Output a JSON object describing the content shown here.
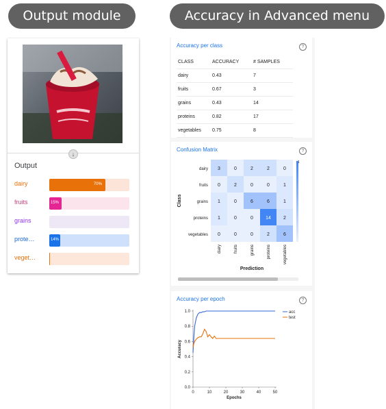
{
  "header": {
    "left_pill": "Output module",
    "right_pill": "Accuracy in Advanced menu"
  },
  "output": {
    "title": "Output",
    "rows": [
      {
        "label": "dairy",
        "value": 0.7,
        "pct": "70%",
        "color": "#e8710a",
        "track": "#fde4d8",
        "text_color": "#e8710a"
      },
      {
        "label": "fruits",
        "value": 0.15,
        "pct": "15%",
        "color": "#e52592",
        "track": "#fce4ec",
        "text_color": "#d93d7b"
      },
      {
        "label": "grains",
        "value": 0.0,
        "pct": "",
        "color": "#9334e6",
        "track": "#ede7f6",
        "text_color": "#9334e6"
      },
      {
        "label": "prote…",
        "value": 0.14,
        "pct": "14%",
        "color": "#1a73e8",
        "track": "#cfe0fc",
        "text_color": "#1967d2"
      },
      {
        "label": "veget…",
        "value": 0.01,
        "pct": "",
        "color": "#e8710a",
        "track": "#fde7da",
        "text_color": "#e8710a"
      }
    ]
  },
  "accuracy_per_class": {
    "title": "Accuracy per class",
    "headers": [
      "CLASS",
      "ACCURACY",
      "# SAMPLES"
    ],
    "rows": [
      [
        "dairy",
        "0.43",
        "7"
      ],
      [
        "fruits",
        "0.67",
        "3"
      ],
      [
        "grains",
        "0.43",
        "14"
      ],
      [
        "proteins",
        "0.82",
        "17"
      ],
      [
        "vegetables",
        "0.75",
        "8"
      ]
    ]
  },
  "confusion_matrix": {
    "title": "Confusion Matrix",
    "ylabel": "Class",
    "xlabel": "Prediction",
    "labels": [
      "dairy",
      "fruits",
      "grains",
      "proteins",
      "vegetables"
    ],
    "matrix": [
      [
        3,
        0,
        2,
        2,
        0
      ],
      [
        0,
        2,
        0,
        0,
        1
      ],
      [
        1,
        0,
        6,
        6,
        1
      ],
      [
        1,
        0,
        0,
        14,
        2
      ],
      [
        0,
        0,
        0,
        2,
        6
      ]
    ],
    "colorbar_top": "1"
  },
  "accuracy_per_epoch": {
    "title": "Accuracy per epoch"
  },
  "chart_data": {
    "type": "line",
    "title": "Accuracy per epoch",
    "xlabel": "Epochs",
    "ylabel": "Accuracy",
    "xlim": [
      0,
      50
    ],
    "ylim": [
      0.0,
      1.0
    ],
    "x_ticks": [
      "0",
      "10",
      "20",
      "30",
      "40",
      "50"
    ],
    "y_ticks": [
      "0.0",
      "0.2",
      "0.4",
      "0.6",
      "0.8",
      "1.0"
    ],
    "grid": false,
    "legend": "right",
    "series": [
      {
        "name": "acc",
        "color": "#3367d6",
        "x": [
          0,
          0.5,
          1,
          2,
          3,
          4,
          5,
          6,
          7,
          8,
          10,
          15,
          20,
          30,
          40,
          50
        ],
        "y": [
          0.45,
          0.65,
          0.8,
          0.91,
          0.96,
          0.98,
          0.98,
          0.99,
          0.99,
          1.0,
          1.0,
          1.0,
          1.0,
          1.0,
          1.0,
          1.0
        ]
      },
      {
        "name": "test",
        "color": "#e8710a",
        "x": [
          0,
          0.5,
          1,
          2,
          3,
          4,
          5,
          6,
          7,
          8,
          9,
          10,
          11,
          12,
          13,
          14,
          15,
          20,
          30,
          40,
          50
        ],
        "y": [
          0.52,
          0.57,
          0.6,
          0.63,
          0.65,
          0.66,
          0.66,
          0.7,
          0.76,
          0.73,
          0.66,
          0.69,
          0.66,
          0.64,
          0.67,
          0.64,
          0.64,
          0.64,
          0.64,
          0.64,
          0.64
        ]
      }
    ]
  }
}
